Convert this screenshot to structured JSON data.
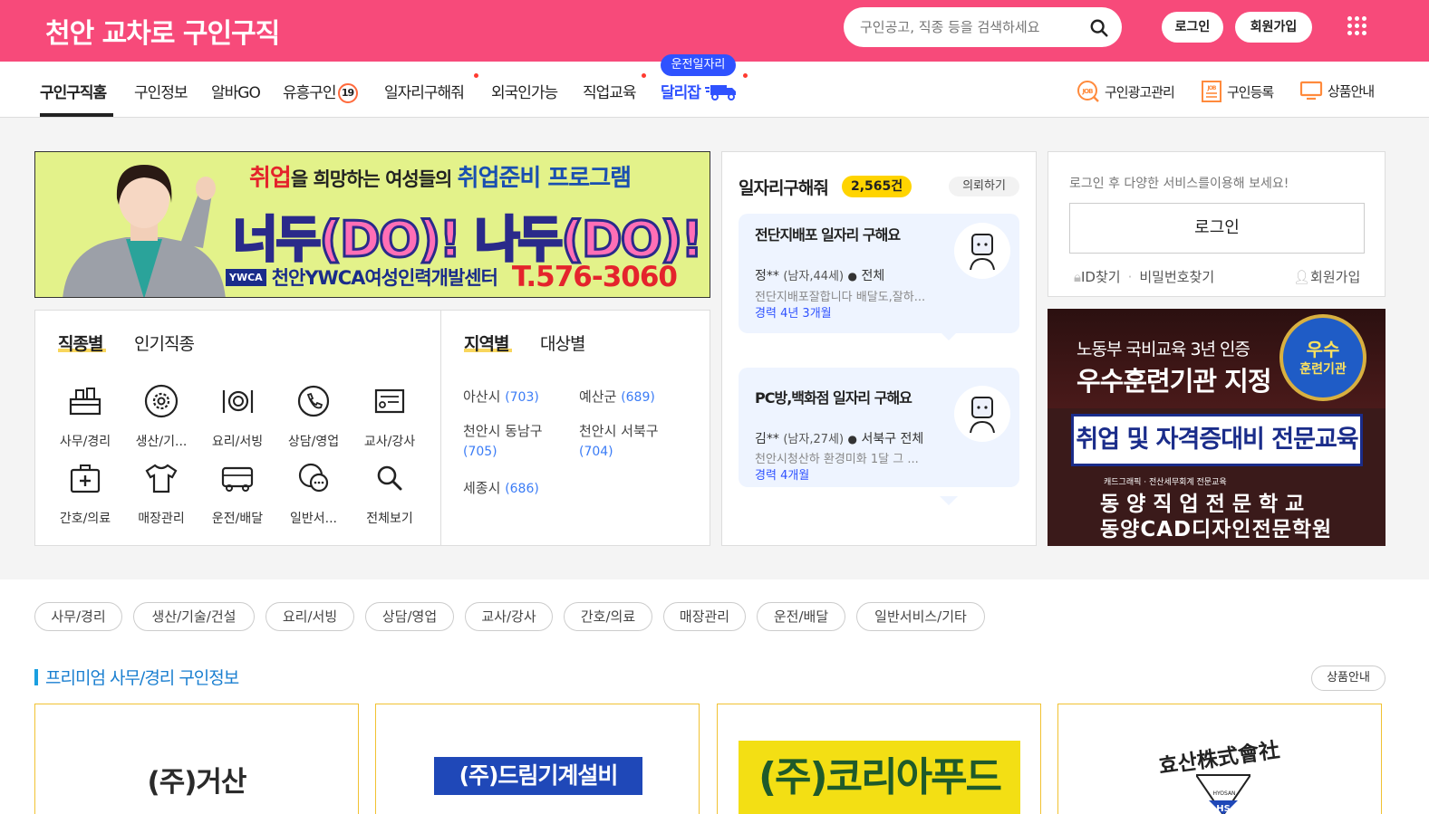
{
  "header": {
    "logo": "천안 교차로 구인구직",
    "search_placeholder": "구인공고, 직종 등을 검색하세요",
    "login": "로그인",
    "signup": "회원가입",
    "colors": {
      "brand": "#f74a7a",
      "accent_blue": "#2f52ff"
    }
  },
  "nav": {
    "items": [
      "구인구직홈",
      "구인정보",
      "알바GO",
      "유흥구인",
      "일자리구해줘",
      "외국인가능",
      "직업교육",
      "달리잡"
    ],
    "badge_19": "19",
    "driver_badge": "운전일자리",
    "right": [
      "구인광고관리",
      "구인등록",
      "상품안내"
    ]
  },
  "banner": {
    "line1a": "취업",
    "line1b": "을 희망하는 여성들의 ",
    "line1c": "취업준비 프로그램",
    "line2": "너두(DO)! 나두(DO)!",
    "org": "천안YWCA여성인력개발센터",
    "phone": "T.576-3060",
    "ywca": "YWCA"
  },
  "categories": {
    "tab_job": "직종별",
    "tab_popular": "인기직종",
    "tab_region": "지역별",
    "tab_target": "대상별",
    "items": [
      "사무/경리",
      "생산/기...",
      "요리/서빙",
      "상담/영업",
      "교사/강사",
      "간호/의료",
      "매장관리",
      "운전/배달",
      "일반서...",
      "전체보기"
    ],
    "regions": [
      {
        "name": "아산시",
        "count": "(703)"
      },
      {
        "name": "예산군",
        "count": "(689)"
      },
      {
        "name": "천안시 동남구",
        "count": "(705)"
      },
      {
        "name": "천안시 서북구",
        "count": "(704)"
      },
      {
        "name": "세종시",
        "count": "(686)"
      }
    ]
  },
  "seekers": {
    "title": "일자리구해줘",
    "count": "2,565건",
    "request": "의뢰하기",
    "cards": [
      {
        "title": "전단지배포 일자리 구해요",
        "name": "정**",
        "info": "(남자,44세)",
        "loc": "전체",
        "desc": "전단지배포잘합니다 배달도,잘하...",
        "career_label": "경력",
        "career": "4년 3개월"
      },
      {
        "title": "PC방,백화점 일자리 구해요",
        "name": "김**",
        "info": "(남자,27세)",
        "loc": "서북구 전체",
        "desc": "천안시청산하 환경미화 1달 그 ...",
        "career_label": "경력",
        "career": "4개월"
      }
    ]
  },
  "login_box": {
    "notice": "로그인 후 다양한 서비스를이용해 보세요!",
    "button": "로그인",
    "find_id": "ID찾기",
    "find_pw": "비밀번호찾기",
    "signup": "회원가입"
  },
  "ad2": {
    "line1": "노동부 국비교육 3년 인증",
    "line2": "우수훈련기관 지정",
    "badge_top": "우수",
    "badge_bottom": "훈련기관",
    "banner": "취업 및 자격증대비 전문교육",
    "small": "캐드그래픽 · 전산세무회계 전문교육",
    "school1": "동 양 직 업 전 문 학 교",
    "school2": "동양CAD디자인전문학원"
  },
  "chips": [
    "사무/경리",
    "생산/기술/건설",
    "요리/서빙",
    "상담/영업",
    "교사/강사",
    "간호/의료",
    "매장관리",
    "운전/배달",
    "일반서비스/기타"
  ],
  "premium": {
    "title": "프리미엄 사무/경리 구인정보",
    "product_info": "상품안내",
    "companies": [
      "(주)거산",
      "(주)드림기계설비",
      "(주)코리아푸드",
      "효산株式會社"
    ],
    "hs": "HS",
    "hyosan_sub": "HYOSAN"
  }
}
